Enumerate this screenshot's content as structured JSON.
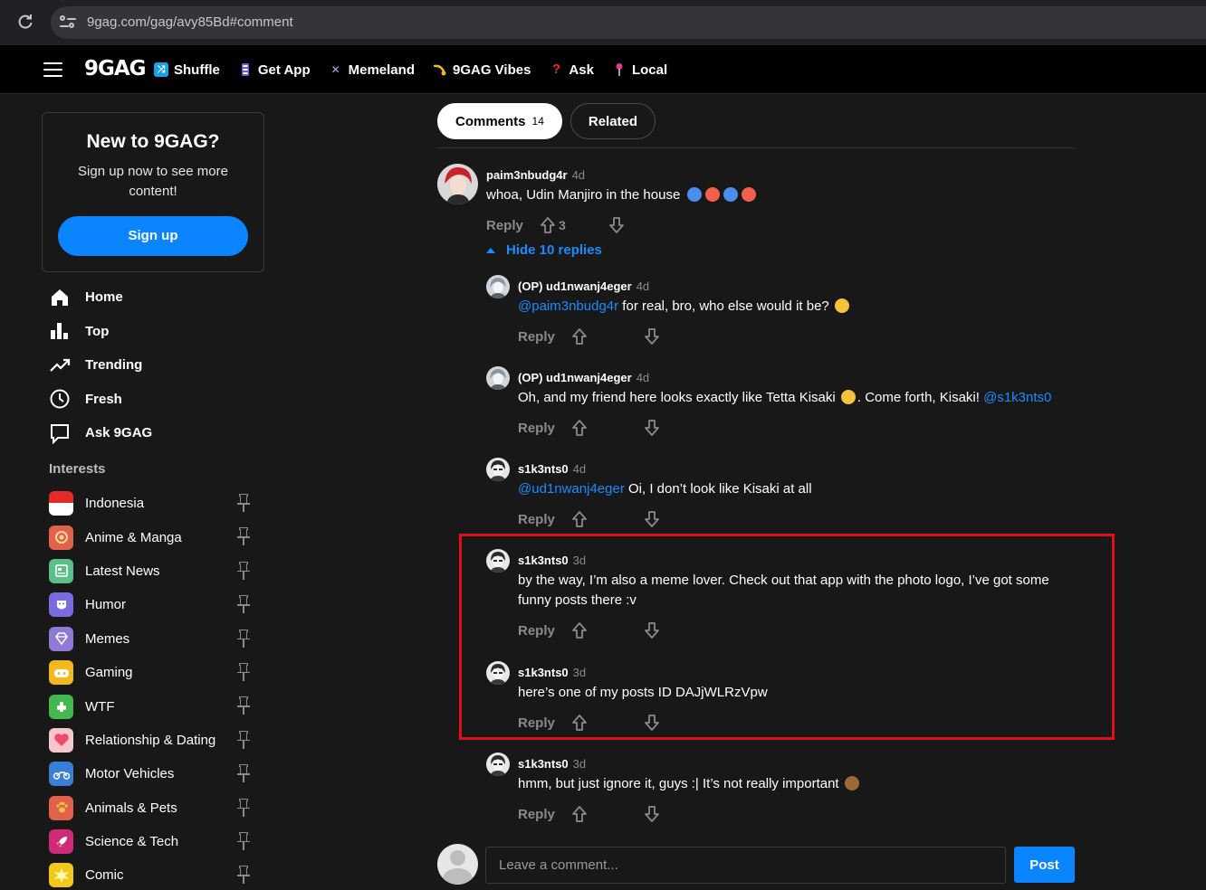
{
  "browser": {
    "url": "9gag.com/gag/avy85Bd#comment"
  },
  "header": {
    "logo": "9GAG",
    "nav": [
      {
        "label": "Shuffle",
        "icon": "shuffle-icon"
      },
      {
        "label": "Get App",
        "icon": "phone-icon"
      },
      {
        "label": "Memeland",
        "icon": "memeland-icon"
      },
      {
        "label": "9GAG Vibes",
        "icon": "vibes-icon"
      },
      {
        "label": "Ask",
        "icon": "question-icon"
      },
      {
        "label": "Local",
        "icon": "location-pin-icon"
      }
    ]
  },
  "signup": {
    "title": "New to 9GAG?",
    "text": "Sign up now to see more content!",
    "button": "Sign up"
  },
  "mainnav": [
    {
      "label": "Home",
      "icon": "home-icon"
    },
    {
      "label": "Top",
      "icon": "bar-chart-icon"
    },
    {
      "label": "Trending",
      "icon": "trending-icon"
    },
    {
      "label": "Fresh",
      "icon": "clock-icon"
    },
    {
      "label": "Ask 9GAG",
      "icon": "speech-bubble-icon"
    }
  ],
  "interests": {
    "label": "Interests",
    "items": [
      {
        "label": "Indonesia",
        "icon": "indonesia-flag-icon",
        "color": "#e52a2a"
      },
      {
        "label": "Anime & Manga",
        "icon": "anime-icon",
        "color": "#e0624a"
      },
      {
        "label": "Latest News",
        "icon": "news-icon",
        "color": "#5cbf8a"
      },
      {
        "label": "Humor",
        "icon": "humor-icon",
        "color": "#7a6be0"
      },
      {
        "label": "Memes",
        "icon": "memes-icon",
        "color": "#8f7ad6"
      },
      {
        "label": "Gaming",
        "icon": "gaming-icon",
        "color": "#f2b820"
      },
      {
        "label": "WTF",
        "icon": "wtf-icon",
        "color": "#43b84f"
      },
      {
        "label": "Relationship & Dating",
        "icon": "heart-icon",
        "color": "#f08a9a"
      },
      {
        "label": "Motor Vehicles",
        "icon": "motorbike-icon",
        "color": "#3a7fd6"
      },
      {
        "label": "Animals & Pets",
        "icon": "paw-icon",
        "color": "#e0624a"
      },
      {
        "label": "Science & Tech",
        "icon": "rocket-icon",
        "color": "#d02a7a"
      },
      {
        "label": "Comic",
        "icon": "comic-icon",
        "color": "#f2c81a"
      }
    ]
  },
  "tabs": {
    "comments_label": "Comments",
    "comments_count": "14",
    "related_label": "Related"
  },
  "comments": {
    "reply_label": "Reply",
    "hide_replies": "Hide 10 replies",
    "top": {
      "author": "paim3nbudg4r",
      "time": "4d",
      "text": "whoa, Udin Manjiro in the house",
      "upvotes": "3"
    },
    "replies": [
      {
        "author": "(OP) ud1nwanj4eger",
        "time": "4d",
        "mention": "@paim3nbudg4r",
        "text": " for real, bro, who else would it be? "
      },
      {
        "author": "(OP) ud1nwanj4eger",
        "time": "4d",
        "text_before": "Oh, and my friend here looks exactly like Tetta Kisaki ",
        "text_after": ". Come forth, Kisaki! ",
        "mention": "@s1k3nts0"
      },
      {
        "author": "s1k3nts0",
        "time": "4d",
        "mention": "@ud1nwanj4eger",
        "text": " Oi, I don’t look like Kisaki at all"
      },
      {
        "author": "s1k3nts0",
        "time": "3d",
        "text": "by the way, I’m also a meme lover. Check out that app with the photo logo, I’ve got some funny posts there :v"
      },
      {
        "author": "s1k3nts0",
        "time": "3d",
        "text": "here’s one of my posts ID DAJjWLRzVpw"
      },
      {
        "author": "s1k3nts0",
        "time": "3d",
        "text": "hmm, but just ignore it, guys :| It’s not really important "
      }
    ]
  },
  "comment_box": {
    "placeholder": "Leave a comment...",
    "post_label": "Post"
  },
  "colors": {
    "accent": "#0a84ff",
    "mention": "#1a8cff",
    "highlight_border": "#e0101a",
    "background": "#181818"
  }
}
